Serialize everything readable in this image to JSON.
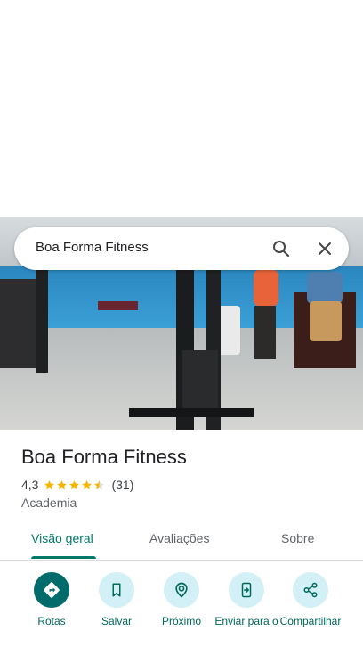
{
  "search": {
    "query": "Boa Forma Fitness"
  },
  "place": {
    "name": "Boa Forma Fitness",
    "rating": "4,3",
    "rating_value": 4.3,
    "review_count": "(31)",
    "category": "Academia"
  },
  "tabs": [
    {
      "label": "Visão geral",
      "active": true
    },
    {
      "label": "Avaliações",
      "active": false
    },
    {
      "label": "Sobre",
      "active": false
    }
  ],
  "actions": [
    {
      "label": "Rotas",
      "icon": "directions-icon"
    },
    {
      "label": "Salvar",
      "icon": "bookmark-icon"
    },
    {
      "label": "Próximo",
      "icon": "nearby-icon"
    },
    {
      "label": "Enviar para o",
      "icon": "send-to-phone-icon"
    },
    {
      "label": "Compartilhar",
      "icon": "share-icon"
    }
  ],
  "colors": {
    "accent": "#00796b",
    "primary_button": "#006b6b",
    "secondary_button": "#d2f0f5",
    "star": "#f4b400"
  }
}
